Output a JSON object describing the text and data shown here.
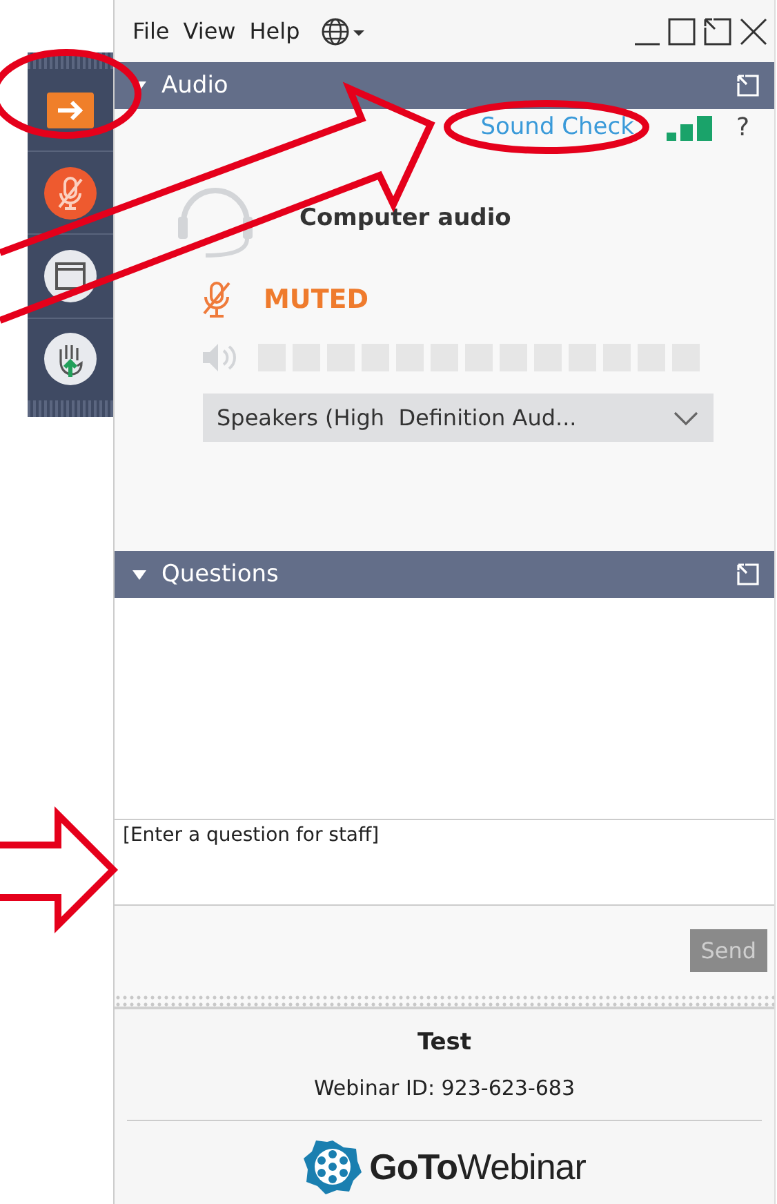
{
  "menu": [
    {
      "label": "File"
    },
    {
      "label": "View"
    },
    {
      "label": "Help"
    }
  ],
  "audio": {
    "title": "Audio",
    "expanded": true,
    "sound_check": "Sound Check",
    "help": "?",
    "mode": "Computer audio",
    "muted": true,
    "status": "MUTED",
    "level": 0,
    "device": "Speakers (High  Definition Aud..."
  },
  "questions": {
    "title": "Questions",
    "expanded": true,
    "placeholder": "[Enter a question for staff]",
    "send": {
      "label": "Send",
      "disabled": true
    }
  },
  "footer": {
    "title": "Test",
    "webinar_id": "Webinar ID: 923-623-683",
    "brand": "**GoTo**Webinar"
  }
}
